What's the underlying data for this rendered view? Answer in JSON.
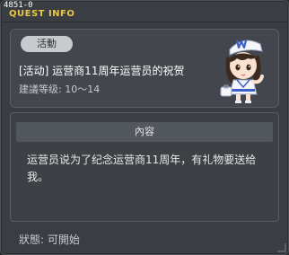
{
  "window": {
    "quest_id": "4851-0",
    "title": "QUEST INFO"
  },
  "summary": {
    "category": "活動",
    "name": "[活动] 运营商11周年运营员的祝贺",
    "level": "建議等级: 10〜14",
    "npc_icon": "npc-operator-character"
  },
  "content": {
    "header": "內容",
    "text": "运营员说为了纪念运营商11周年，有礼物要送给我。"
  },
  "footer": {
    "status": "狀態:  可開始"
  }
}
